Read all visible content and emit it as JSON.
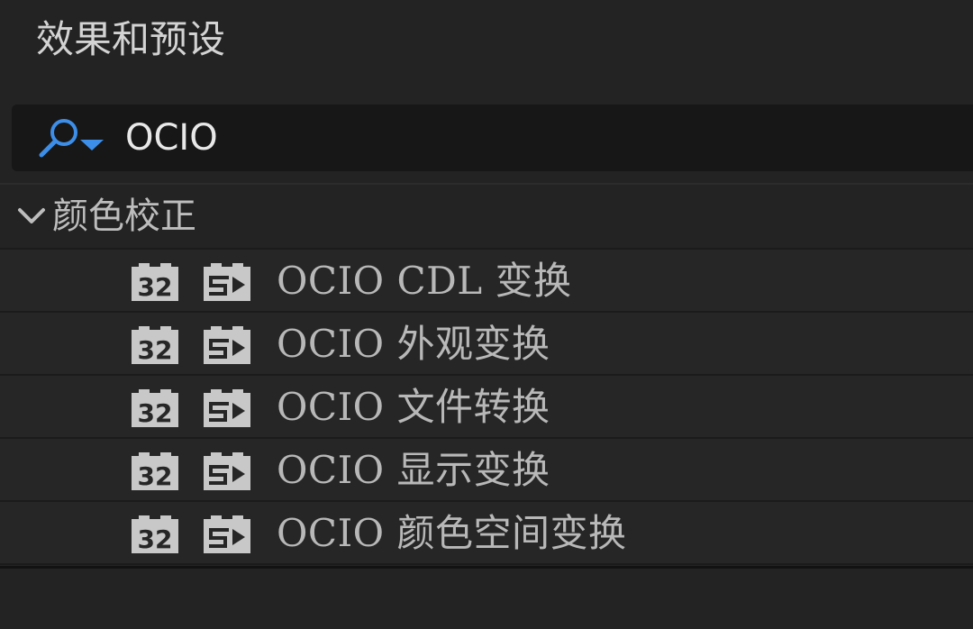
{
  "panel": {
    "title": "效果和预设"
  },
  "search": {
    "value": "OCIO",
    "icon": "search-dropdown-icon",
    "icon_color": "#3d8ee8"
  },
  "group": {
    "label": "颜色校正",
    "expanded": true,
    "icon": "chevron-down-icon"
  },
  "effects": [
    {
      "label": "OCIO CDL 变换",
      "badges": [
        "32",
        "fx"
      ]
    },
    {
      "label": "OCIO 外观变换",
      "badges": [
        "32",
        "fx"
      ]
    },
    {
      "label": "OCIO 文件转换",
      "badges": [
        "32",
        "fx"
      ]
    },
    {
      "label": "OCIO 显示变换",
      "badges": [
        "32",
        "fx"
      ]
    },
    {
      "label": "OCIO 颜色空间变换",
      "badges": [
        "32",
        "fx"
      ]
    }
  ],
  "badge32": {
    "text": "32",
    "icon": "32-bit-badge-icon"
  },
  "badgeFx": {
    "icon": "accelerated-effect-badge-icon"
  },
  "colors": {
    "background": "#232323",
    "row_background": "#262626",
    "search_background": "#171717",
    "accent": "#3d8ee8",
    "text": "#bdbdbd"
  }
}
